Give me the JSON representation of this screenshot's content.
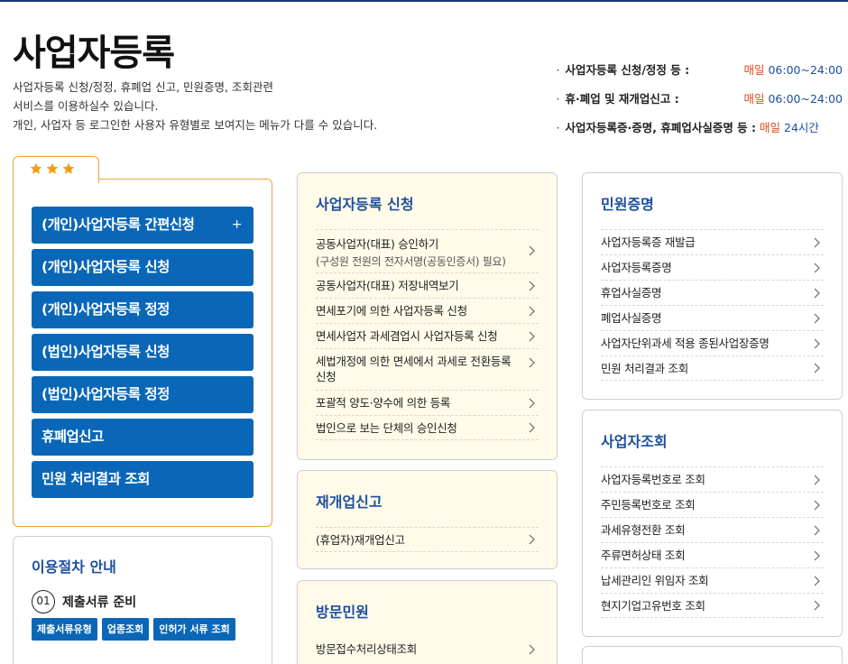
{
  "header": {
    "title": "사업자등록",
    "desc": [
      "사업자등록 신청/정정, 휴폐업 신고, 민원증명, 조회관련",
      "서비스를 이용하실수 있습니다.",
      "개인, 사업자 등 로그인한 사용자 유형별로 보여지는 메뉴가 다를 수 있습니다."
    ]
  },
  "hours": [
    {
      "label": "사업자등록 신청/정정 등 :",
      "daily": "매일",
      "time": "06:00~24:00"
    },
    {
      "label": "휴·폐업 및 재개업신고 :",
      "daily": "매일",
      "time": "06:00~24:00"
    },
    {
      "label": "사업자등록증·증명, 휴폐업사실증명 등 :",
      "daily": "매일",
      "time": "24시간"
    }
  ],
  "favorites": {
    "stars": [
      "star-icon",
      "star-icon",
      "star-icon"
    ],
    "buttons": [
      "(개인)사업자등록 간편신청",
      "(개인)사업자등록 신청",
      "(개인)사업자등록 정정",
      "(법인)사업자등록 신청",
      "(법인)사업자등록 정정",
      "휴폐업신고",
      "민원 처리결과 조회"
    ],
    "plus_icon": "+"
  },
  "guide": {
    "title": "이용절차 안내",
    "step1": {
      "num": "01",
      "label": "제출서류 준비"
    },
    "chips": [
      "제출서류유형",
      "업종조회",
      "인허가 서류 조회"
    ]
  },
  "cards": {
    "registration": {
      "title": "사업자등록 신청",
      "items": [
        {
          "text": "공동사업자(대표) 승인하기",
          "sub": "(구성원 전원의 전자서명(공동인증서) 필요)"
        },
        {
          "text": "공동사업자(대표) 저장내역보기"
        },
        {
          "text": "면세포기에 의한 사업자등록 신청"
        },
        {
          "text": "면세사업자 과세겸업시 사업자등록 신청"
        },
        {
          "text": "세법개정에 의한 면세에서 과세로 전환등록 신청"
        },
        {
          "text": "포괄적 양도·양수에 의한 등록"
        },
        {
          "text": "법인으로 보는 단체의 승인신청"
        }
      ]
    },
    "reopen": {
      "title": "재개업신고",
      "items": [
        {
          "text": "(휴업자)재개업신고"
        }
      ]
    },
    "visit": {
      "title": "방문민원",
      "items": [
        {
          "text": "방문접수처리상태조회"
        }
      ]
    },
    "certificate": {
      "title": "민원증명",
      "items": [
        {
          "text": "사업자등록증 재발급"
        },
        {
          "text": "사업자등록증명"
        },
        {
          "text": "휴업사실증명"
        },
        {
          "text": "폐업사실증명"
        },
        {
          "text": "사업자단위과세 적용 종된사업장증명"
        },
        {
          "text": "민원 처리결과 조회"
        }
      ]
    },
    "lookup": {
      "title": "사업자조회",
      "items": [
        {
          "text": "사업자등록번호로 조회"
        },
        {
          "text": "주민등록번호로 조회"
        },
        {
          "text": "과세유형전환 조회"
        },
        {
          "text": "주류면허상태 조회"
        },
        {
          "text": "납세관리인 위임자 조회"
        },
        {
          "text": "현지기업고유번호 조회"
        }
      ]
    }
  },
  "icons": {
    "chevron": "chevron-right-icon",
    "star": "star-icon",
    "step": "step-number"
  },
  "colors": {
    "primary_button": "#0a67b8",
    "title_blue": "#1d4fa0",
    "accent_orange": "#e7a43a",
    "daily_red": "#e04a1a",
    "card_yellow": "#fffbe8"
  }
}
